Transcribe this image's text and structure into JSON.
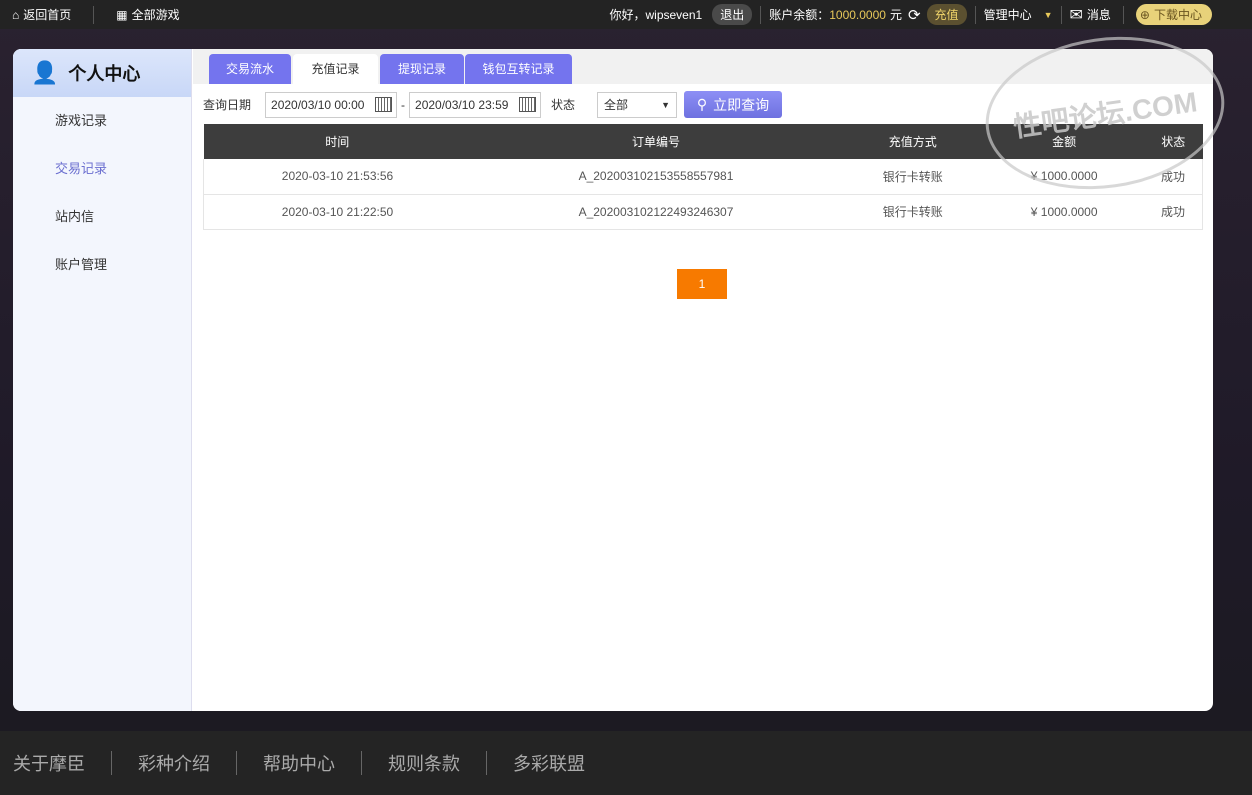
{
  "topbar": {
    "home": "返回首页",
    "all_games": "全部游戏",
    "greeting": "你好，wipseven1",
    "logout": "退出",
    "balance_label": "账户余额：",
    "balance": "1000.0000",
    "currency": "元",
    "recharge": "充值",
    "manage": "管理中心",
    "messages": "消息",
    "download": "下载中心"
  },
  "sidebar": {
    "title": "个人中心",
    "items": [
      {
        "label": "游戏记录"
      },
      {
        "label": "交易记录"
      },
      {
        "label": "站内信"
      },
      {
        "label": "账户管理"
      }
    ]
  },
  "tabs": [
    {
      "label": "交易流水"
    },
    {
      "label": "充值记录"
    },
    {
      "label": "提现记录"
    },
    {
      "label": "钱包互转记录"
    }
  ],
  "filter": {
    "date_label": "查询日期",
    "start": "2020/03/10 00:00",
    "dash": "-",
    "end": "2020/03/10 23:59",
    "status_label": "状态",
    "status_value": "全部",
    "query": "立即查询"
  },
  "table": {
    "headers": [
      "时间",
      "订单编号",
      "充值方式",
      "金额",
      "状态"
    ],
    "rows": [
      [
        "2020-03-10 21:53:56",
        "A_202003102153558557981",
        "银行卡转账",
        "¥ 1000.0000",
        "成功"
      ],
      [
        "2020-03-10 21:22:50",
        "A_202003102122493246307",
        "银行卡转账",
        "¥ 1000.0000",
        "成功"
      ]
    ]
  },
  "pagination": {
    "current": "1"
  },
  "footer": {
    "links": [
      "关于摩臣",
      "彩种介绍",
      "帮助中心",
      "规则条款",
      "多彩联盟"
    ]
  },
  "watermark": "性吧论坛.COM"
}
